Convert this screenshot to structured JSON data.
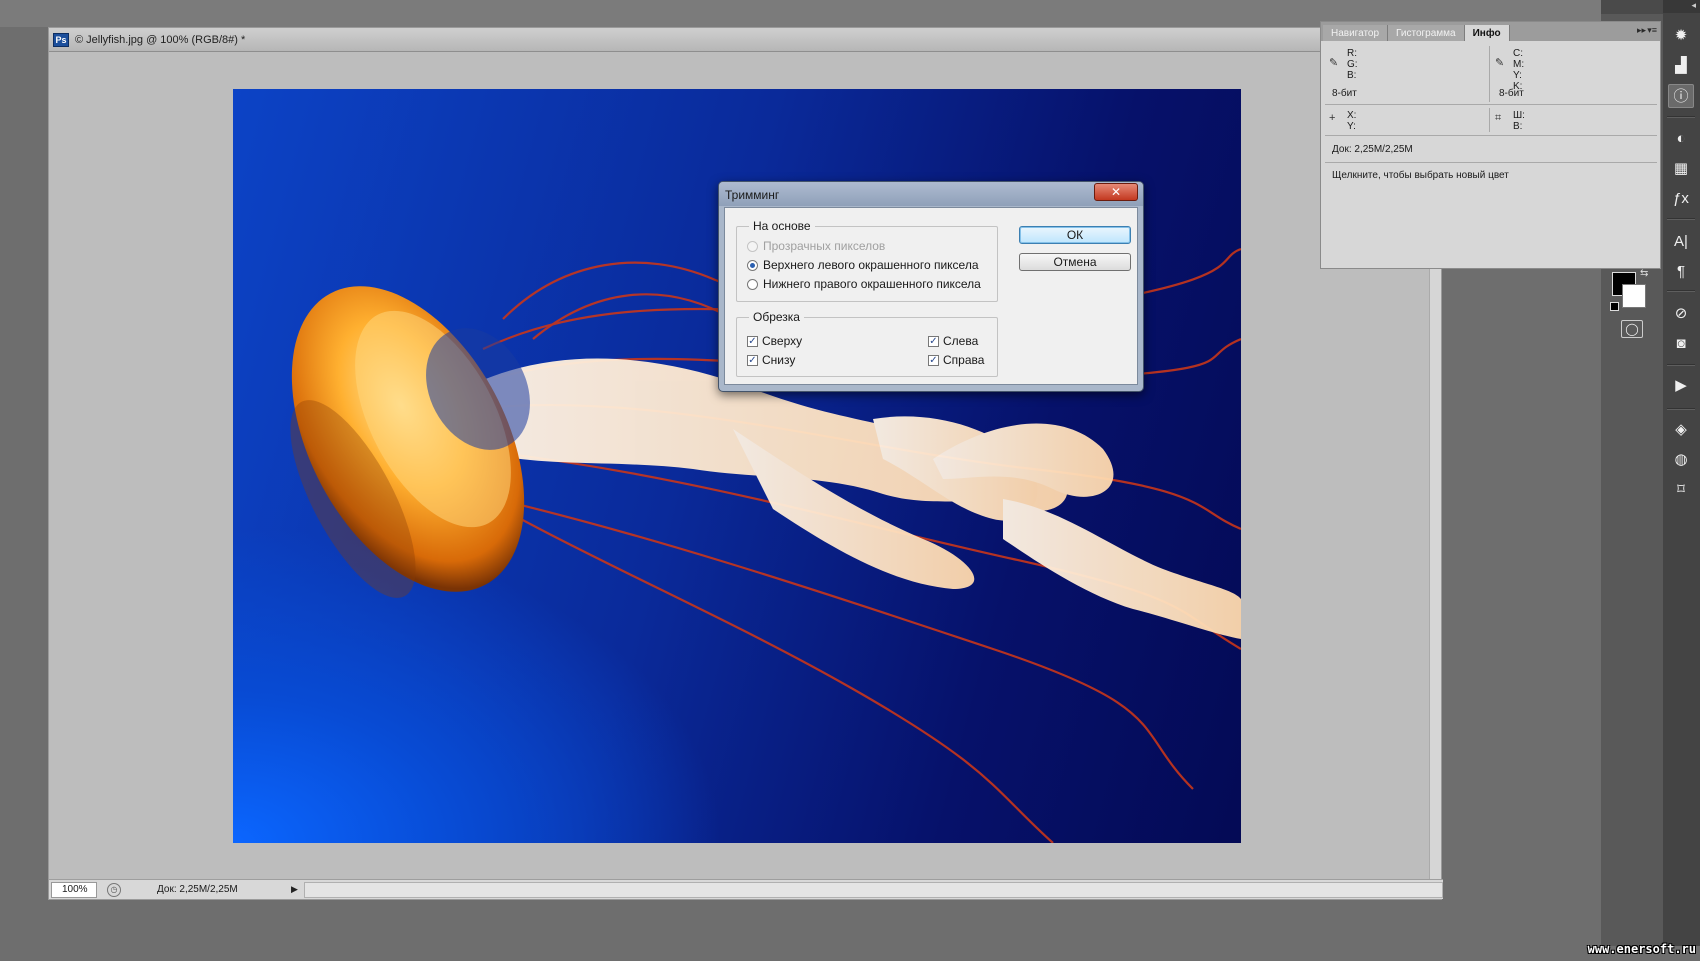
{
  "document": {
    "app_icon": "Ps",
    "title": "© Jellyfish.jpg @ 100% (RGB/8#) *",
    "zoom": "100%",
    "doc_size": "Док: 2,25M/2,25M"
  },
  "dialog": {
    "title": "Тримминг",
    "close_symbol": "✕",
    "group_basis_label": "На основе",
    "options": [
      "Прозрачных пикселов",
      "Верхнего левого окрашенного пиксела",
      "Нижнего правого окрашенного пиксела"
    ],
    "selected_option": "Верхнего левого окрашенного пиксела",
    "group_trim_label": "Обрезка",
    "trim": {
      "top": "Сверху",
      "bottom": "Снизу",
      "left": "Слева",
      "right": "Справа"
    },
    "ok_label": "ОК",
    "cancel_label": "Отмена"
  },
  "info_panel": {
    "tabs": [
      "Навигатор",
      "Гистограмма",
      "Инфо"
    ],
    "active_tab": "Инфо",
    "rgb_labels": "R:\nG:\nB:",
    "cmyk_labels": "C:\nM:\nY:\nK:",
    "bit_left": "8-бит",
    "bit_right": "8-бит",
    "xy_labels": "X:\nY:",
    "wh_labels": "Ш:\nВ:",
    "doc_size": "Док: 2,25M/2,25M",
    "hint": "Щелкните, чтобы выбрать новый цвет"
  },
  "dock_icons": [
    "navigator-icon",
    "histogram-icon",
    "info-icon",
    "color-icon",
    "swatches-icon",
    "styles-icon",
    "character-icon",
    "paragraph-icon",
    "brush-icon",
    "clone-source-icon",
    "actions-icon",
    "layers-icon",
    "channels-icon",
    "paths-icon"
  ],
  "watermark": "www.enersoft.ru"
}
